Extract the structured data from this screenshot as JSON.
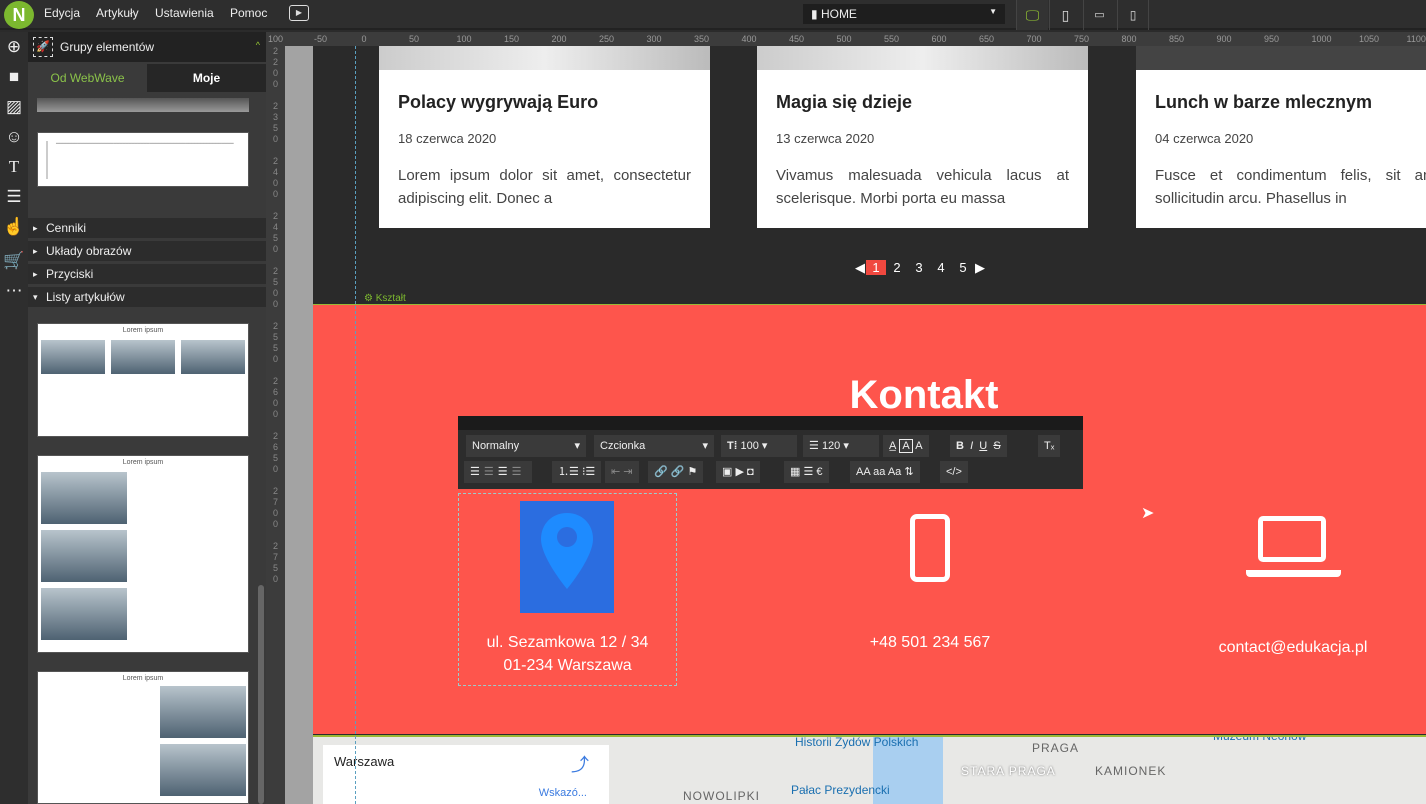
{
  "menu": {
    "items": [
      "Edycja",
      "Artykuły",
      "Ustawienia",
      "Pomoc"
    ]
  },
  "page_select": "HOME",
  "panel": {
    "title": "Grupy elementów",
    "tabs": [
      "Od WebWave",
      "Moje"
    ],
    "categories": [
      "Cenniki",
      "Układy obrazów",
      "Przyciski",
      "Listy artykułów"
    ],
    "thumb_title": "Lorem ipsum"
  },
  "ruler": [
    "100",
    "-50",
    "0",
    "50",
    "100",
    "150",
    "200",
    "250",
    "300",
    "350",
    "400",
    "450",
    "500",
    "550",
    "600",
    "650",
    "700",
    "750",
    "800",
    "850",
    "900",
    "950",
    "1000",
    "1050",
    "1100"
  ],
  "cards": [
    {
      "title": "Polacy wygrywają Euro",
      "date": "18 czerwca 2020",
      "text": "Lorem ipsum dolor sit amet, consectetur adipiscing elit. Donec a"
    },
    {
      "title": "Magia się dzieje",
      "date": "13 czerwca 2020",
      "text": "Vivamus malesuada vehicula lacus at scelerisque. Morbi porta eu massa"
    },
    {
      "title": "Lunch w barze mlecznym",
      "date": "04 czerwca 2020",
      "text": "Fusce et condimentum felis, sit amet sollicitudin arcu. Phasellus in"
    }
  ],
  "pager": [
    "1",
    "2",
    "3",
    "4",
    "5"
  ],
  "shape_label": "Kształt",
  "contact": {
    "title": "Kontakt",
    "address1": "ul. Sezamkowa 12 / 34",
    "address2": "01-234 Warszawa",
    "phone": "+48 501 234 567",
    "email": "contact@edukacja.pl"
  },
  "toolbar": {
    "style": "Normalny",
    "font": "Czcionka",
    "size": "100",
    "line_height": "120",
    "case_upper": "AA",
    "case_lower": "aa",
    "case_title": "Aa"
  },
  "map": {
    "city": "Warszawa",
    "directions": "Wskazó...",
    "labels": [
      "Historii Żydów Polskich",
      "PRAGA",
      "STARA PRAGA",
      "KAMIONEK",
      "NOWOLIPKI",
      "Pałac Prezydencki",
      "Muzeum Neonów"
    ]
  }
}
